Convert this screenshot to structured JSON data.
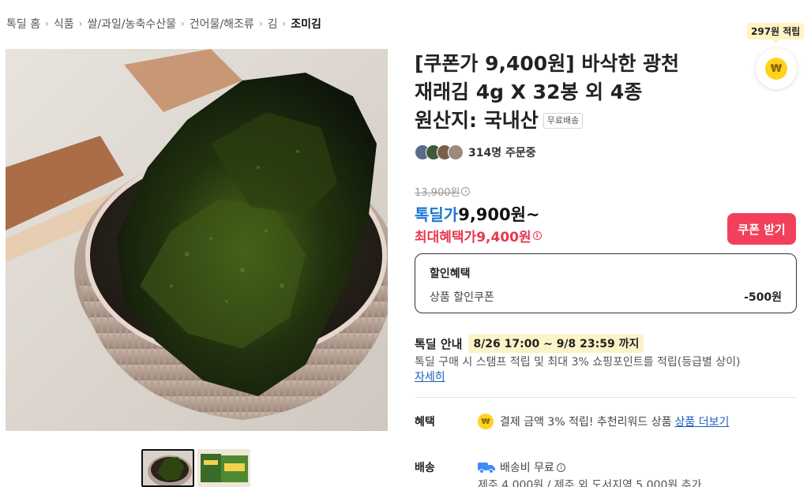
{
  "breadcrumb": {
    "items": [
      "톡딜 홈",
      "식품",
      "쌀/과일/농축수산물",
      "건어물/해조류",
      "김"
    ],
    "current": "조미김",
    "separator": "›"
  },
  "points": {
    "badge": "297원 적립",
    "coin_symbol": "₩"
  },
  "product": {
    "title_lines": [
      "[쿠폰가 9,400원] 바삭한 광천",
      "재래김 4g X 32봉 외 4종",
      "원산지: 국내산"
    ],
    "shipping_tag": "무료배송",
    "orders": "314명 주문중"
  },
  "price": {
    "original": "13,900원",
    "deal_label": "톡딜가",
    "deal_value": "9,900원~",
    "max_label": "최대혜택가",
    "max_value": "9,400원",
    "info_glyph": "i"
  },
  "coupon_button": "쿠폰 받기",
  "discount": {
    "title": "할인혜택",
    "row_name": "상품 할인쿠폰",
    "row_amount": "-500원"
  },
  "deal_info": {
    "label": "톡딜 안내",
    "period": "8/26 17:00 ~ 9/8 23:59 까지",
    "description": "톡딜 구매 시 스탬프 적립 및 최대 3% 쇼핑포인트를 적립(등급별 상이)",
    "link": "자세히"
  },
  "benefit": {
    "label": "혜택",
    "coin": "₩",
    "text": "결제 금액 3% 적립! 추천리워드 상품",
    "link": "상품 더보기"
  },
  "shipping": {
    "label": "배송",
    "text": "배송비 무료",
    "sub": "제주 4,000원 / 제주 외 도서지역 5,000원 추가"
  },
  "colors": {
    "accent_blue": "#1976d2",
    "accent_red": "#e8384f",
    "coupon_button": "#f2405c",
    "link_blue": "#1b5dc1",
    "point_yellow": "#ffd21f"
  }
}
